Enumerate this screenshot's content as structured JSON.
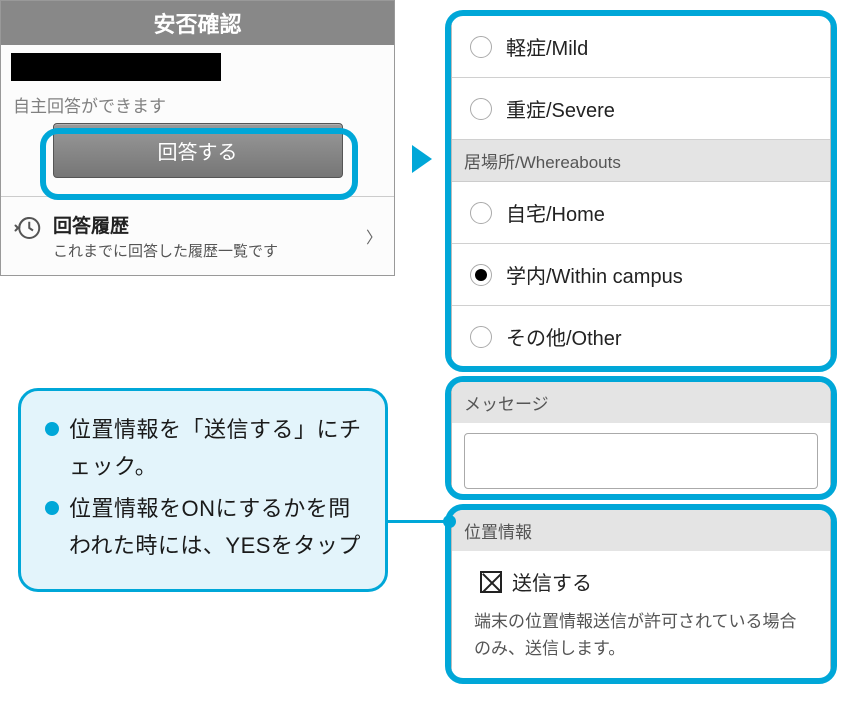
{
  "left_panel": {
    "title": "安否確認",
    "self_answer_label": "自主回答ができます",
    "answer_button": "回答する",
    "history": {
      "title": "回答履歴",
      "desc": "これまでに回答した履歴一覧です"
    }
  },
  "form": {
    "severity": {
      "options": [
        {
          "label": "軽症/Mild",
          "selected": false
        },
        {
          "label": "重症/Severe",
          "selected": false
        }
      ]
    },
    "whereabouts": {
      "header": "居場所/Whereabouts",
      "options": [
        {
          "label": "自宅/Home",
          "selected": false
        },
        {
          "label": "学内/Within campus",
          "selected": true
        },
        {
          "label": "その他/Other",
          "selected": false
        }
      ]
    },
    "message": {
      "header": "メッセージ",
      "value": ""
    },
    "location": {
      "header": "位置情報",
      "checkbox_label": "送信する",
      "checked": true,
      "note": "端末の位置情報送信が許可されている場合のみ、送信します。"
    }
  },
  "callout": {
    "items": [
      "位置情報を「送信する」にチェック。",
      "位置情報をONにするかを問われた時には、YESをタップ"
    ]
  }
}
